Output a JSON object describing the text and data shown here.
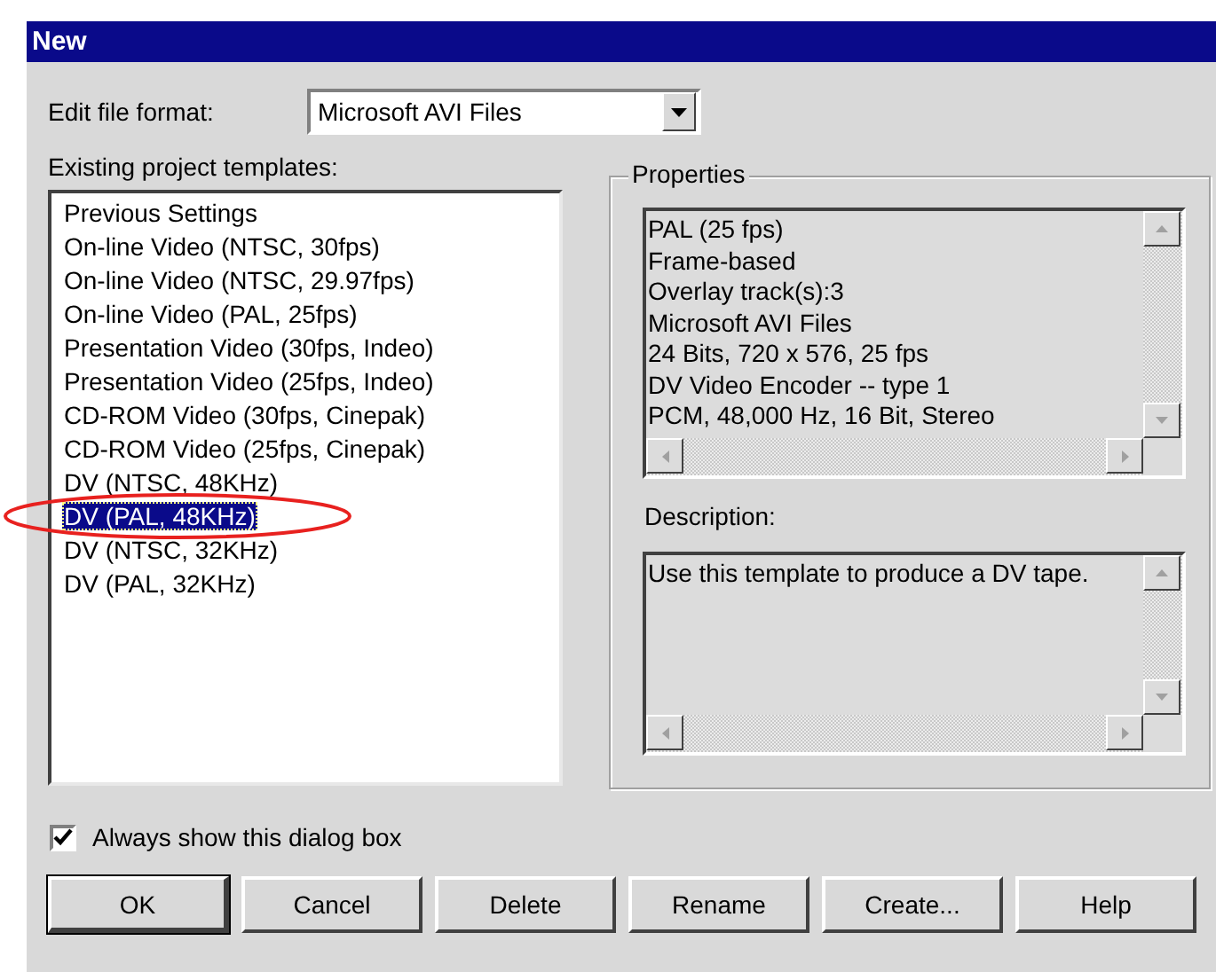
{
  "window": {
    "title": "New"
  },
  "edit_file_format": {
    "label": "Edit file format:",
    "value": "Microsoft AVI Files"
  },
  "templates": {
    "label": "Existing project templates:",
    "items": [
      {
        "label": "Previous Settings",
        "selected": false
      },
      {
        "label": "On-line Video (NTSC, 30fps)",
        "selected": false
      },
      {
        "label": "On-line Video (NTSC, 29.97fps)",
        "selected": false
      },
      {
        "label": "On-line Video (PAL, 25fps)",
        "selected": false
      },
      {
        "label": "Presentation Video (30fps, Indeo)",
        "selected": false
      },
      {
        "label": "Presentation Video (25fps, Indeo)",
        "selected": false
      },
      {
        "label": "CD-ROM Video (30fps, Cinepak)",
        "selected": false
      },
      {
        "label": "CD-ROM Video (25fps, Cinepak)",
        "selected": false
      },
      {
        "label": "DV (NTSC, 48KHz)",
        "selected": false
      },
      {
        "label": "DV (PAL, 48KHz)",
        "selected": true
      },
      {
        "label": "DV (NTSC, 32KHz)",
        "selected": false
      },
      {
        "label": "DV (PAL, 32KHz)",
        "selected": false
      }
    ]
  },
  "properties": {
    "title": "Properties",
    "lines": [
      "PAL (25 fps)",
      "Frame-based",
      "Overlay track(s):3",
      "Microsoft AVI Files",
      "24 Bits, 720 x 576, 25 fps",
      "DV Video Encoder -- type 1",
      "PCM, 48,000 Hz, 16 Bit, Stereo"
    ]
  },
  "description": {
    "label": "Description:",
    "text": "Use this template to produce a DV tape."
  },
  "always_show": {
    "label": "Always show this dialog box",
    "checked": true
  },
  "buttons": [
    {
      "label": "OK",
      "default": true
    },
    {
      "label": "Cancel",
      "default": false
    },
    {
      "label": "Delete",
      "default": false
    },
    {
      "label": "Rename",
      "default": false
    },
    {
      "label": "Create...",
      "default": false
    },
    {
      "label": "Help",
      "default": false
    }
  ],
  "annotation": {
    "kind": "ellipse"
  }
}
